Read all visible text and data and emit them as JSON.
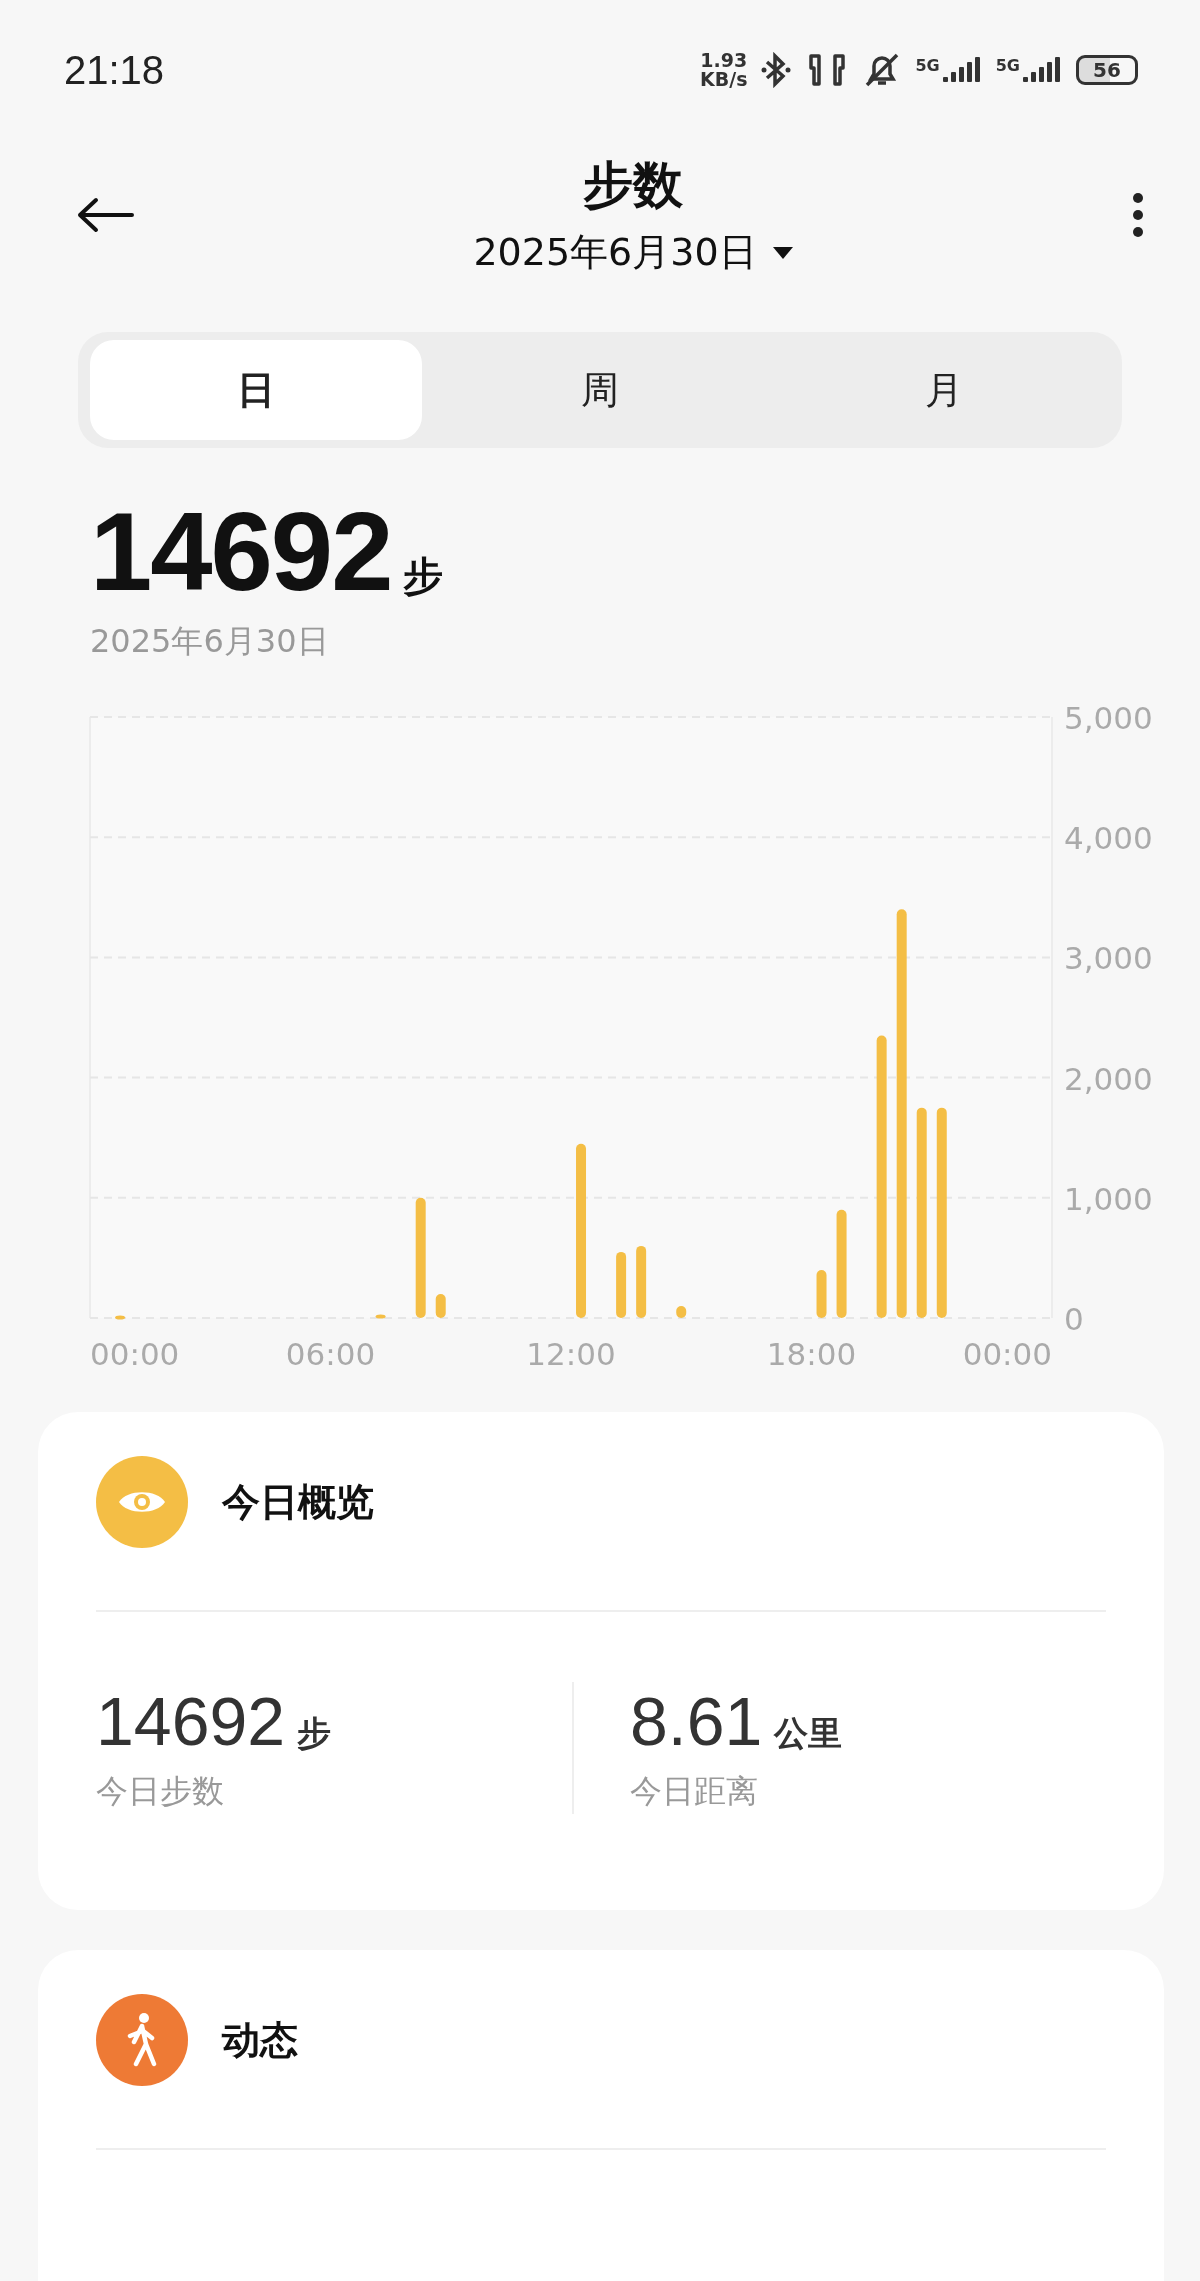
{
  "status_bar": {
    "time": "21:18",
    "speed_value": "1.93",
    "speed_unit": "KB/s",
    "networks": [
      "5G",
      "5G"
    ],
    "battery": "56"
  },
  "header": {
    "title": "步数",
    "date": "2025年6月30日"
  },
  "tabs": [
    {
      "label": "日",
      "selected": true
    },
    {
      "label": "周",
      "selected": false
    },
    {
      "label": "月",
      "selected": false
    }
  ],
  "summary": {
    "total": "14692",
    "unit": "步",
    "date": "2025年6月30日"
  },
  "chart_data": {
    "type": "bar",
    "x": [
      0.75,
      7.25,
      8.25,
      8.75,
      12.25,
      13.25,
      13.75,
      14.75,
      18.25,
      18.75,
      19.75,
      20.25,
      20.75,
      21.25
    ],
    "values": [
      20,
      30,
      1000,
      200,
      1450,
      550,
      600,
      100,
      400,
      900,
      2350,
      3400,
      1750,
      1750
    ],
    "grid": true,
    "xlim": [
      0,
      24
    ],
    "ylim": [
      0,
      5000
    ],
    "xticks": [
      {
        "value": 0,
        "label": "00:00"
      },
      {
        "value": 6,
        "label": "06:00"
      },
      {
        "value": 12,
        "label": "12:00"
      },
      {
        "value": 18,
        "label": "18:00"
      },
      {
        "value": 24,
        "label": "00:00"
      }
    ],
    "yticks": [
      {
        "value": 0,
        "label": "0"
      },
      {
        "value": 1000,
        "label": "1,000"
      },
      {
        "value": 2000,
        "label": "2,000"
      },
      {
        "value": 3000,
        "label": "3,000"
      },
      {
        "value": 4000,
        "label": "4,000"
      },
      {
        "value": 5000,
        "label": "5,000"
      }
    ]
  },
  "cards": [
    {
      "kind": "overview",
      "title": "今日概览",
      "stats": [
        {
          "value": "14692",
          "unit": "步",
          "label": "今日步数"
        },
        {
          "value": "8.61",
          "unit": "公里",
          "label": "今日距离"
        }
      ]
    },
    {
      "kind": "activity",
      "title": "动态"
    }
  ]
}
